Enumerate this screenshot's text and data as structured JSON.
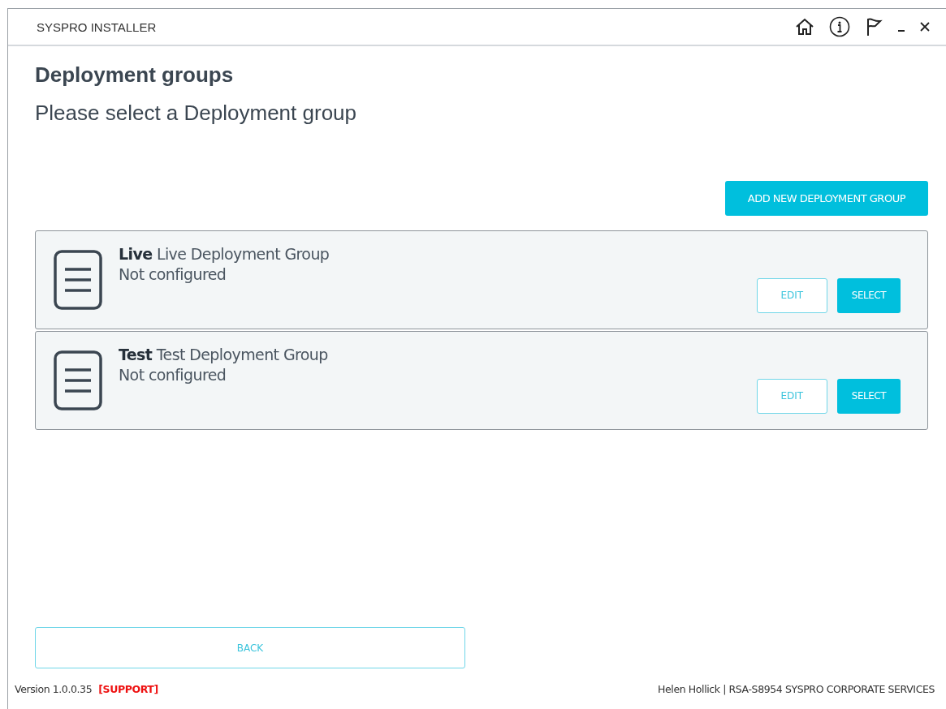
{
  "window": {
    "title": "SYSPRO INSTALLER"
  },
  "header": {
    "title": "Deployment groups",
    "subtitle": "Please select a Deployment group"
  },
  "add_button": "ADD NEW DEPLOYMENT GROUP",
  "groups": [
    {
      "title": "**Live** Live Deployment Group",
      "status": "Not configured",
      "edit": "EDIT",
      "select": "SELECT"
    },
    {
      "title": "**Test** Test Deployment Group",
      "status": "Not configured",
      "edit": "EDIT",
      "select": "SELECT"
    }
  ],
  "back_button": "BACK",
  "footer": {
    "version": "Version 1.0.0.35",
    "support": "[SUPPORT]",
    "user": "Helen Hollick | RSA-S8954 SYSPRO CORPORATE SERVICES"
  }
}
